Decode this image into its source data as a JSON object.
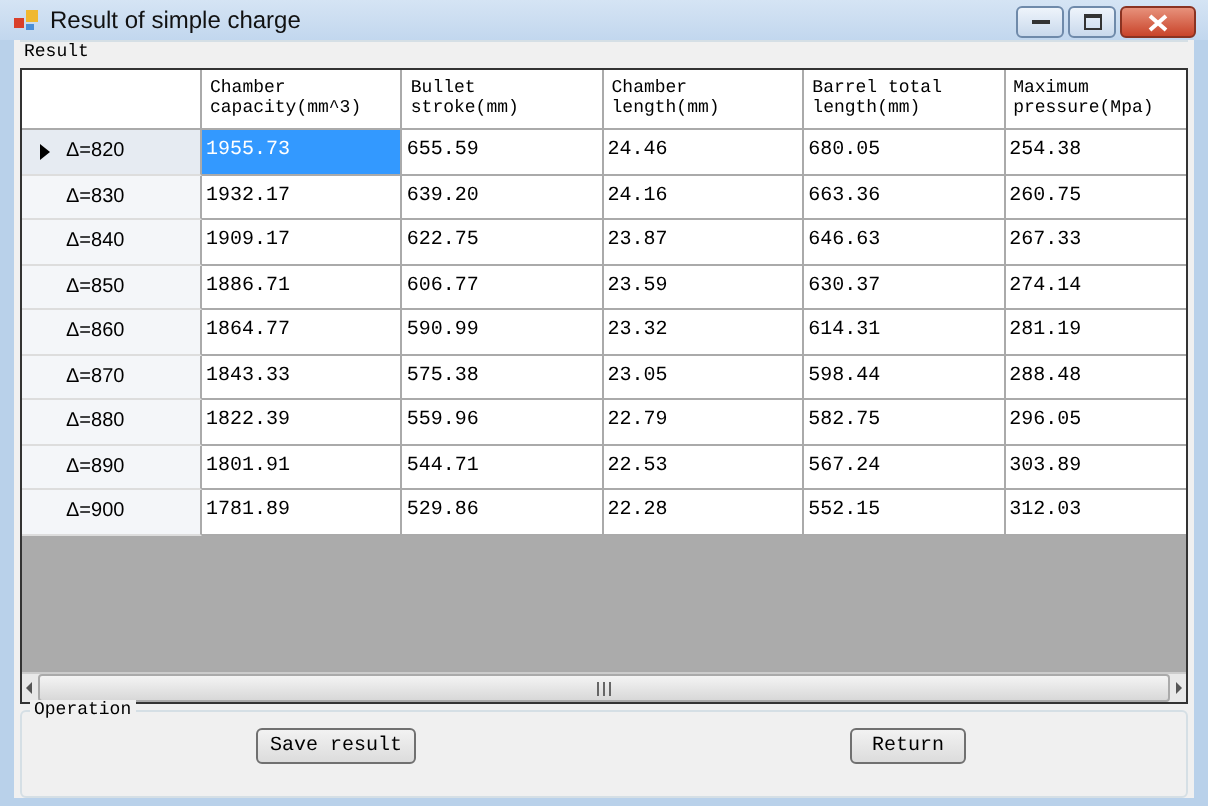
{
  "window": {
    "title": "Result of simple charge"
  },
  "result_group": {
    "label": "Result"
  },
  "table": {
    "columns": [
      "Chamber\ncapacity(mm^3)",
      "Bullet\nstroke(mm)",
      "Chamber\nlength(mm)",
      "Barrel total\nlength(mm)",
      "Maximum\npressure(Mpa)"
    ],
    "rows": [
      {
        "label": "Δ=820",
        "selected": true,
        "cells": [
          {
            "text": "1955.73",
            "selected": true
          },
          {
            "text": "655.59",
            "selected": false
          },
          {
            "text": "24.46",
            "selected": false
          },
          {
            "text": "680.05",
            "selected": false
          },
          {
            "text": "254.38",
            "selected": false
          }
        ]
      },
      {
        "label": "Δ=830",
        "selected": false,
        "cells": [
          {
            "text": "1932.17",
            "selected": false
          },
          {
            "text": "639.20",
            "selected": false
          },
          {
            "text": "24.16",
            "selected": false
          },
          {
            "text": "663.36",
            "selected": false
          },
          {
            "text": "260.75",
            "selected": false
          }
        ]
      },
      {
        "label": "Δ=840",
        "selected": false,
        "cells": [
          {
            "text": "1909.17",
            "selected": false
          },
          {
            "text": "622.75",
            "selected": false
          },
          {
            "text": "23.87",
            "selected": false
          },
          {
            "text": "646.63",
            "selected": false
          },
          {
            "text": "267.33",
            "selected": false
          }
        ]
      },
      {
        "label": "Δ=850",
        "selected": false,
        "cells": [
          {
            "text": "1886.71",
            "selected": false
          },
          {
            "text": "606.77",
            "selected": false
          },
          {
            "text": "23.59",
            "selected": false
          },
          {
            "text": "630.37",
            "selected": false
          },
          {
            "text": "274.14",
            "selected": false
          }
        ]
      },
      {
        "label": "Δ=860",
        "selected": false,
        "cells": [
          {
            "text": "1864.77",
            "selected": false
          },
          {
            "text": "590.99",
            "selected": false
          },
          {
            "text": "23.32",
            "selected": false
          },
          {
            "text": "614.31",
            "selected": false
          },
          {
            "text": "281.19",
            "selected": false
          }
        ]
      },
      {
        "label": "Δ=870",
        "selected": false,
        "cells": [
          {
            "text": "1843.33",
            "selected": false
          },
          {
            "text": "575.38",
            "selected": false
          },
          {
            "text": "23.05",
            "selected": false
          },
          {
            "text": "598.44",
            "selected": false
          },
          {
            "text": "288.48",
            "selected": false
          }
        ]
      },
      {
        "label": "Δ=880",
        "selected": false,
        "cells": [
          {
            "text": "1822.39",
            "selected": false
          },
          {
            "text": "559.96",
            "selected": false
          },
          {
            "text": "22.79",
            "selected": false
          },
          {
            "text": "582.75",
            "selected": false
          },
          {
            "text": "296.05",
            "selected": false
          }
        ]
      },
      {
        "label": "Δ=890",
        "selected": false,
        "cells": [
          {
            "text": "1801.91",
            "selected": false
          },
          {
            "text": "544.71",
            "selected": false
          },
          {
            "text": "22.53",
            "selected": false
          },
          {
            "text": "567.24",
            "selected": false
          },
          {
            "text": "303.89",
            "selected": false
          }
        ]
      },
      {
        "label": "Δ=900",
        "selected": false,
        "cells": [
          {
            "text": "1781.89",
            "selected": false
          },
          {
            "text": "529.86",
            "selected": false
          },
          {
            "text": "22.28",
            "selected": false
          },
          {
            "text": "552.15",
            "selected": false
          },
          {
            "text": "312.03",
            "selected": false
          }
        ]
      }
    ]
  },
  "operation_group": {
    "label": "Operation"
  },
  "buttons": [
    "Save result",
    "Return"
  ]
}
